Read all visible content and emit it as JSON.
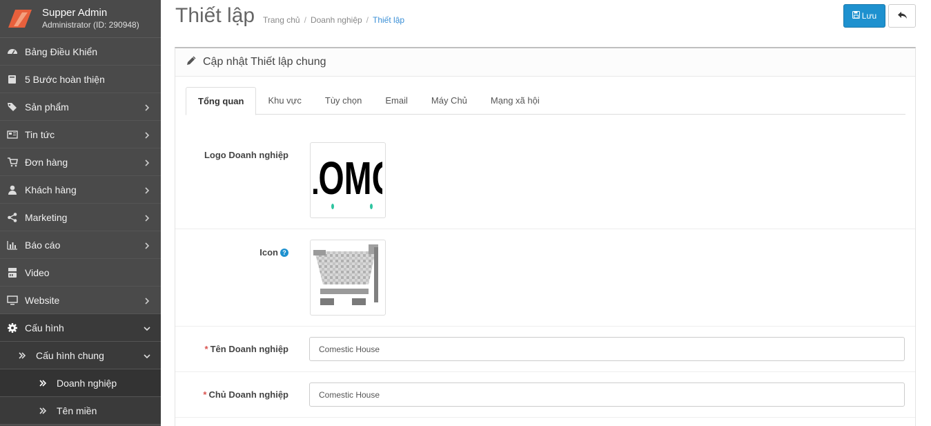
{
  "profile": {
    "name": "Supper Admin",
    "role": "Administrator (ID: 290948)"
  },
  "sidebar": {
    "items": [
      {
        "label": "Bảng Điều Khiển",
        "icon": "dashboard-icon",
        "chevron": false
      },
      {
        "label": "5 Bước hoàn thiện",
        "icon": "book-icon",
        "chevron": false
      },
      {
        "label": "Sản phẩm",
        "icon": "tags-icon",
        "chevron": true
      },
      {
        "label": "Tin tức",
        "icon": "newspaper-icon",
        "chevron": true
      },
      {
        "label": "Đơn hàng",
        "icon": "cart-icon",
        "chevron": true
      },
      {
        "label": "Khách hàng",
        "icon": "user-icon",
        "chevron": true
      },
      {
        "label": "Marketing",
        "icon": "share-icon",
        "chevron": true
      },
      {
        "label": "Báo cáo",
        "icon": "bar-chart-icon",
        "chevron": true
      },
      {
        "label": "Video",
        "icon": "youtube-icon",
        "chevron": false
      },
      {
        "label": "Website",
        "icon": "monitor-icon",
        "chevron": true
      },
      {
        "label": "Cấu hình",
        "icon": "gear-icon",
        "chevron": "down"
      }
    ],
    "sub": {
      "label": "Cấu hình chung"
    },
    "subsub": [
      {
        "label": "Doanh nghiệp"
      },
      {
        "label": "Tên miền"
      }
    ]
  },
  "header": {
    "title": "Thiết lập",
    "breadcrumb": [
      "Trang chủ",
      "Doanh nghiệp",
      "Thiết lập"
    ],
    "save_label": "Lưu"
  },
  "panel": {
    "heading": "Cập nhật Thiết lập chung",
    "tabs": [
      "Tổng quan",
      "Khu vực",
      "Tùy chọn",
      "Email",
      "Máy Chủ",
      "Mạng xã hội"
    ],
    "active_tab": "Tổng quan"
  },
  "form": {
    "logo_label": "Logo Doanh nghiệp",
    "logo_text": "LOMO",
    "icon_label": "Icon",
    "help_glyph": "?",
    "required_mark": "*",
    "company_name_label": "Tên Doanh nghiệp",
    "company_name_value": "Comestic House",
    "owner_label": "Chủ Doanh nghiệp",
    "owner_value": "Comestic House"
  },
  "colors": {
    "primary": "#1e91cf",
    "sidebar": "#4a4a4a",
    "accent": "#e8603c"
  }
}
